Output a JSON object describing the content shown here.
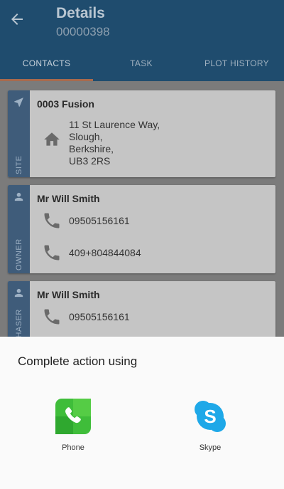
{
  "header": {
    "title": "Details",
    "subtitle": "00000398",
    "tabs": [
      {
        "label": "CONTACTS",
        "active": true
      },
      {
        "label": "TASK",
        "active": false
      },
      {
        "label": "PLOT HISTORY",
        "active": false
      }
    ]
  },
  "cards": {
    "site": {
      "label": "SITE",
      "name": "0003 Fusion",
      "address": [
        "11 St Laurence Way,",
        "Slough,",
        "Berkshire,",
        "UB3 2RS"
      ]
    },
    "owner": {
      "label": "OWNER",
      "name": "Mr Will Smith",
      "phones": [
        "09505156161",
        "409+804844084"
      ]
    },
    "chaser": {
      "label": "CHASER",
      "name": "Mr Will Smith",
      "phones": [
        "09505156161"
      ]
    }
  },
  "sheet": {
    "title": "Complete action using",
    "apps": [
      {
        "label": "Phone",
        "icon": "phone-app-icon"
      },
      {
        "label": "Skype",
        "icon": "skype-app-icon"
      }
    ]
  },
  "colors": {
    "appbar": "#1f4c6e",
    "tab_indicator": "#a86a4d",
    "card_strip": "#3f5c7a",
    "phone_green": "#3fbd3a",
    "skype_blue": "#1ea8e8"
  }
}
